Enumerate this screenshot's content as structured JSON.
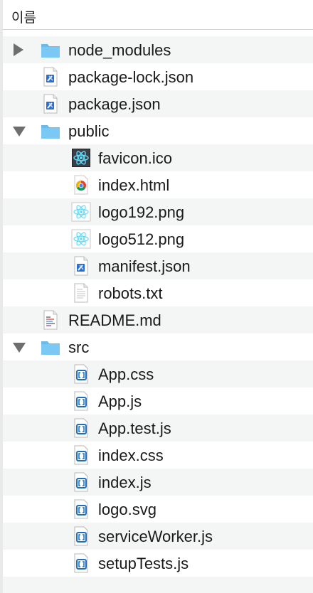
{
  "header": {
    "column_label": "이름"
  },
  "tree": {
    "rows": [
      {
        "label": "node_modules",
        "type": "folder"
      },
      {
        "label": "package-lock.json",
        "type": "json"
      },
      {
        "label": "package.json",
        "type": "json"
      },
      {
        "label": "public",
        "type": "folder"
      },
      {
        "label": "favicon.ico",
        "type": "react"
      },
      {
        "label": "index.html",
        "type": "chrome"
      },
      {
        "label": "logo192.png",
        "type": "react-light"
      },
      {
        "label": "logo512.png",
        "type": "react-light"
      },
      {
        "label": "manifest.json",
        "type": "json"
      },
      {
        "label": "robots.txt",
        "type": "text"
      },
      {
        "label": "README.md",
        "type": "markdown"
      },
      {
        "label": "src",
        "type": "folder"
      },
      {
        "label": "App.css",
        "type": "code"
      },
      {
        "label": "App.js",
        "type": "code"
      },
      {
        "label": "App.test.js",
        "type": "code"
      },
      {
        "label": "index.css",
        "type": "code"
      },
      {
        "label": "index.js",
        "type": "code"
      },
      {
        "label": "logo.svg",
        "type": "code"
      },
      {
        "label": "serviceWorker.js",
        "type": "code"
      },
      {
        "label": "setupTests.js",
        "type": "code"
      }
    ]
  },
  "colors": {
    "folder": "#7cc8f5",
    "folder_tab": "#6bbaea",
    "row_stripe": "#f4f5f5",
    "disclosure": "#6e6e6e",
    "code_icon": "#1e6fbf",
    "react": "#61dafb"
  }
}
